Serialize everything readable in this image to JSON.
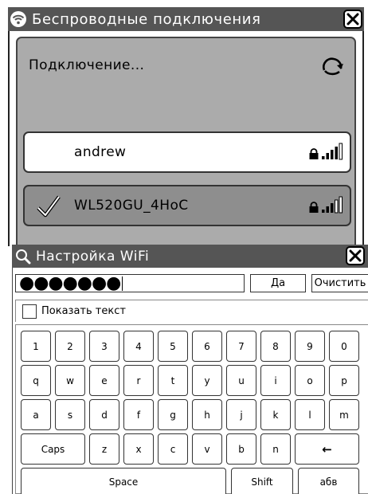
{
  "wireless_window": {
    "title": "Беспроводные подключения",
    "status": "Подключение...",
    "networks": [
      {
        "name": "andrew",
        "connected": false
      },
      {
        "name": "WL520GU_4HoC",
        "connected": true
      }
    ]
  },
  "wifi_dialog": {
    "title": "Настройка WiFi",
    "password_masked": "●●●●●●●",
    "ok_label": "Да",
    "clear_label": "Очистить",
    "show_text_label": "Показать текст"
  },
  "keyboard": {
    "row1": [
      "1",
      "2",
      "3",
      "4",
      "5",
      "6",
      "7",
      "8",
      "9",
      "0"
    ],
    "row2": [
      "q",
      "w",
      "e",
      "r",
      "t",
      "y",
      "u",
      "i",
      "o",
      "p"
    ],
    "row3": [
      "a",
      "s",
      "d",
      "f",
      "g",
      "h",
      "j",
      "k",
      "l",
      "m"
    ],
    "row4": [
      "Caps",
      "z",
      "x",
      "c",
      "v",
      "b",
      "n",
      "←"
    ],
    "row5": [
      "Space",
      "Shift",
      "абв"
    ]
  },
  "colors": {
    "titlebar": "#555555",
    "panel": "#ababab",
    "selected_item": "#8e8e8e"
  }
}
